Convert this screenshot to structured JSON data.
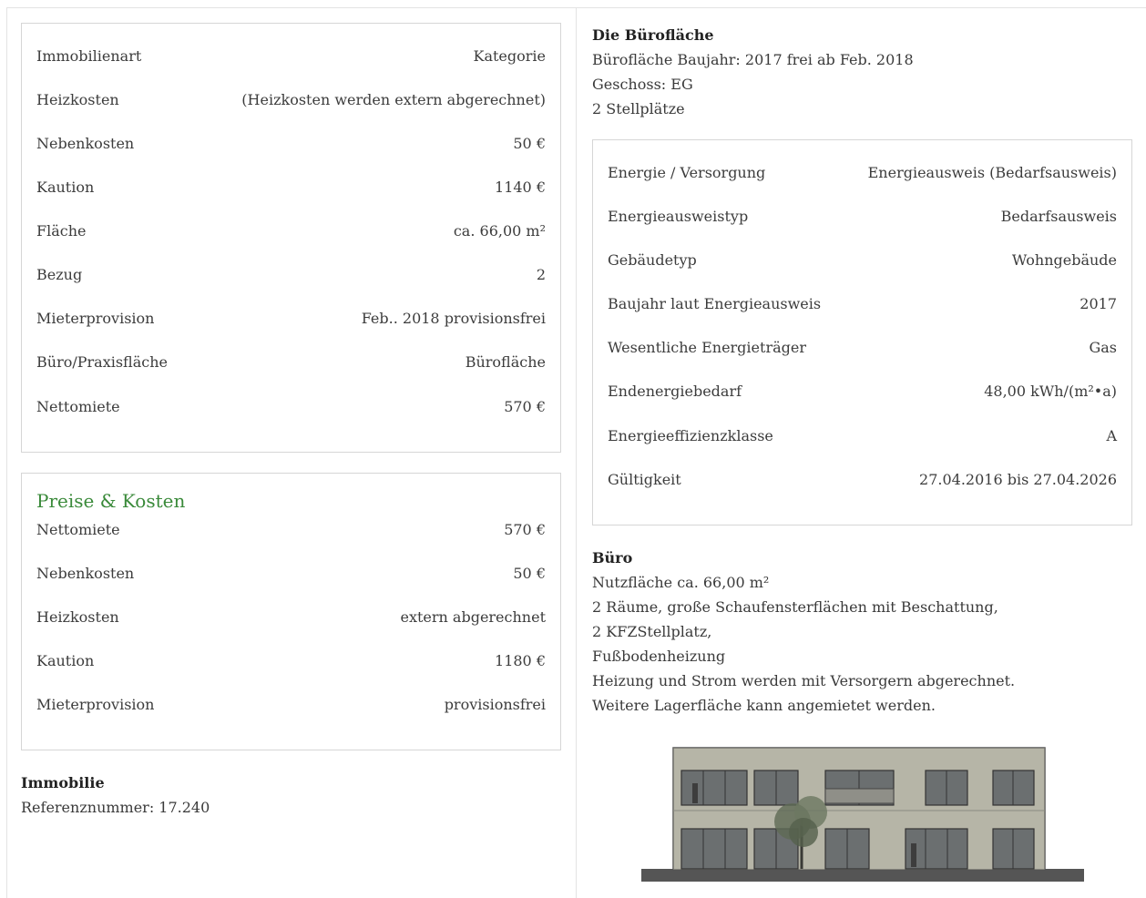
{
  "details": {
    "rows": [
      {
        "label": "Immobilienart",
        "value": "Kategorie"
      },
      {
        "label": "Heizkosten",
        "value": "(Heizkosten werden extern abgerechnet)"
      },
      {
        "label": "Nebenkosten",
        "value": "50 €"
      },
      {
        "label": "Kaution",
        "value": "1140 €"
      },
      {
        "label": "Fläche",
        "value": "ca. 66,00 m²"
      },
      {
        "label": "Bezug",
        "value": "2"
      },
      {
        "label": "Mieterprovision",
        "value": "Feb.. 2018 provisionsfrei"
      },
      {
        "label": "Büro/Praxisfläche",
        "value": "Bürofläche"
      },
      {
        "label": "Nettomiete",
        "value": "570 €"
      }
    ]
  },
  "prices": {
    "title": "Preise & Kosten",
    "rows": [
      {
        "label": "Nettomiete",
        "value": "570 €"
      },
      {
        "label": "Nebenkosten",
        "value": "50 €"
      },
      {
        "label": "Heizkosten",
        "value": "extern abgerechnet"
      },
      {
        "label": "Kaution",
        "value": "1180 €"
      },
      {
        "label": "Mieterprovision",
        "value": "provisionsfrei"
      }
    ]
  },
  "immobilie": {
    "heading": "Immobilie",
    "reference": "Referenznummer: 17.240"
  },
  "buerofl": {
    "heading": "Die Bürofläche",
    "lines": [
      "Bürofläche Baujahr: 2017 frei ab Feb. 2018",
      "Geschoss: EG",
      "2 Stellplätze"
    ]
  },
  "energy": {
    "rows": [
      {
        "label": "Energie / Versorgung",
        "value": "Energieausweis (Bedarfsausweis)"
      },
      {
        "label": "Energieausweistyp",
        "value": "Bedarfsausweis"
      },
      {
        "label": "Gebäudetyp",
        "value": "Wohngebäude"
      },
      {
        "label": "Baujahr laut Energieausweis",
        "value": "2017"
      },
      {
        "label": "Wesentliche Energieträger",
        "value": "Gas"
      },
      {
        "label": "Endenergiebedarf",
        "value": "48,00 kWh/(m²•a)"
      },
      {
        "label": "Energieeffizienzklasse",
        "value": "A"
      },
      {
        "label": "Gültigkeit",
        "value": "27.04.2016 bis 27.04.2026"
      }
    ]
  },
  "buero": {
    "heading": "Büro",
    "lines": [
      "Nutzfläche ca. 66,00 m²",
      "2 Räume, große Schaufensterflächen mit Beschattung,",
      "2 KFZStellplatz,",
      "Fußbodenheizung",
      "Heizung und Strom werden mit Versorgern abgerechnet.",
      "Weitere Lagerfläche kann angemietet werden."
    ]
  }
}
